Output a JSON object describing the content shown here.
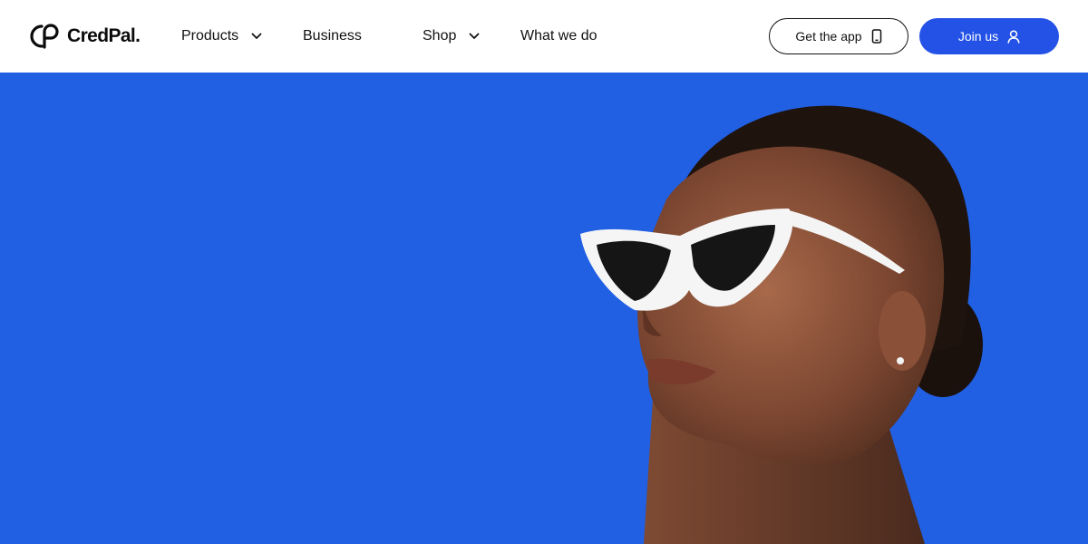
{
  "brand": {
    "name": "CredPal.",
    "logo_icon": "credpal-logo-icon"
  },
  "nav": {
    "items": [
      {
        "label": "Products",
        "has_dropdown": true
      },
      {
        "label": "Business",
        "has_dropdown": false
      },
      {
        "label": "Shop",
        "has_dropdown": true
      },
      {
        "label": "What we do",
        "has_dropdown": false
      }
    ]
  },
  "actions": {
    "get_app_label": "Get the app",
    "get_app_icon": "smartphone-icon",
    "join_label": "Join us",
    "join_icon": "user-icon"
  },
  "colors": {
    "accent": "#2452e6",
    "hero_bg": "#2160e3",
    "text": "#0b0b0b"
  },
  "hero": {
    "image": "woman-white-cat-eye-sunglasses-photo"
  }
}
